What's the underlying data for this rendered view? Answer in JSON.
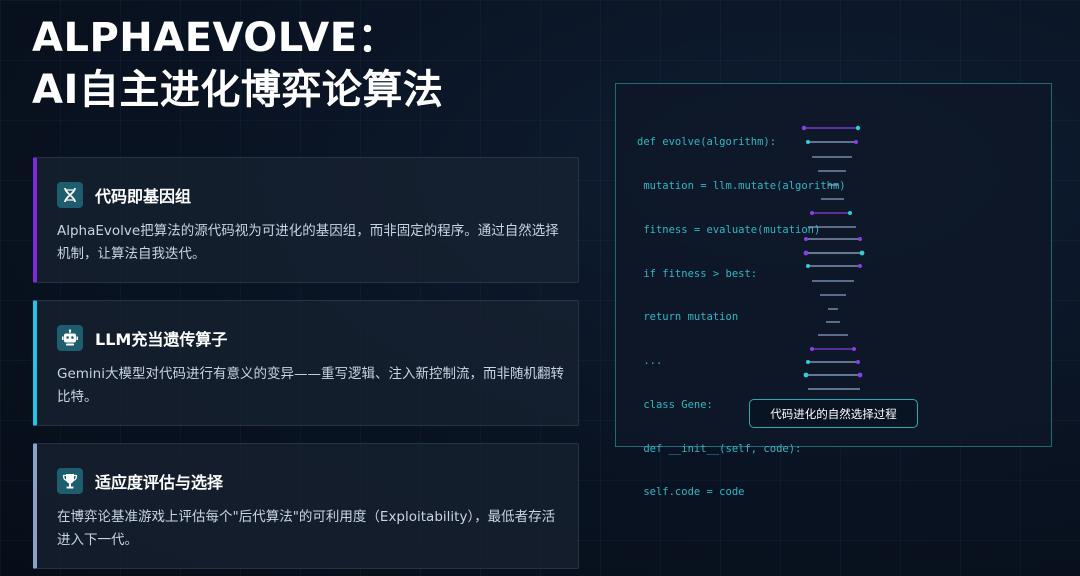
{
  "title": {
    "line1": "ALPHAEVOLVE：",
    "line2": "AI自主进化博弈论算法"
  },
  "cards": [
    {
      "icon": "dna-icon",
      "accent": "#7b2bd9",
      "title": "代码即基因组",
      "body": "AlphaEvolve把算法的源代码视为可进化的基因组，而非固定的程序。通过自然选择机制，让算法自我迭代。"
    },
    {
      "icon": "robot-icon",
      "accent": "#1fc6e6",
      "title": "LLM充当遗传算子",
      "body": "Gemini大模型对代码进行有意义的变异——重写逻辑、注入新控制流，而非随机翻转比特。"
    },
    {
      "icon": "trophy-icon",
      "accent": "#8aa2c8",
      "title": "适应度评估与选择",
      "body": "在博弈论基准游戏上评估每个\"后代算法\"的可利用度（Exploitability），最低者存活进入下一代。"
    }
  ],
  "code_panel": {
    "lines": [
      "def evolve(algorithm):",
      " mutation = llm.mutate(algorithm)",
      " fitness = evaluate(mutation)",
      " if fitness > best:",
      " return mutation",
      " ...",
      " class Gene:",
      " def __init__(self, code):",
      " self.code = code"
    ],
    "caption": "代码进化的自然选择过程"
  },
  "colors": {
    "code_text": "#2fb8c4",
    "helix_purple": "#8a3ee8",
    "helix_cyan": "#2ad0d8"
  }
}
